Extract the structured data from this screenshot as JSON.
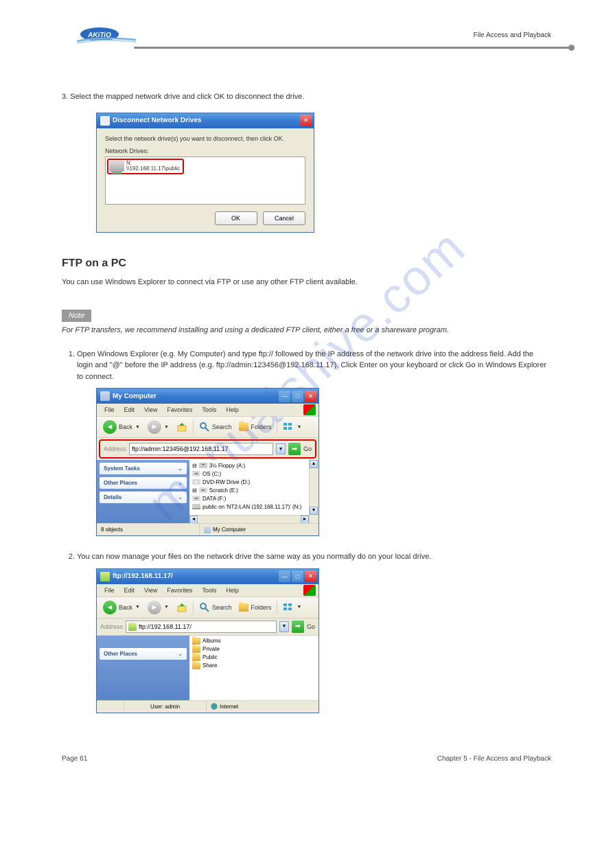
{
  "header": {
    "logo_text": "AKiTiO",
    "section_name": "File Access and Playback"
  },
  "intro_text": "3.  Select the mapped network drive and click OK to disconnect the drive.",
  "dialog1": {
    "title": "Disconnect Network Drives",
    "instruction": "Select the network drive(s) you want to disconnect, then click OK.",
    "label": "Network Drives:",
    "item_line1": "N:",
    "item_line2": "\\\\192.168.11.17\\public",
    "ok": "OK",
    "cancel": "Cancel"
  },
  "ftp_section": {
    "title": "FTP on a PC",
    "intro": "You can use Windows Explorer to connect via FTP or use any other FTP client available.",
    "note_label": "Note",
    "note_text": "For FTP transfers, we recommend installing and using a dedicated FTP client, either a free or a shareware program.",
    "steps": [
      "Open Windows Explorer (e.g. My Computer) and type ftp:// followed by the IP address of the network drive into the address field. Add the login and \"@\" before the IP address (e.g. ftp://admin:123456@192.168.11.17). Click Enter on your keyboard or click Go in Windows Explorer to connect.",
      "You can now manage your files on the network drive the same way as you normally do on your local drive."
    ]
  },
  "explorer1": {
    "title": "My Computer",
    "menus": [
      "File",
      "Edit",
      "View",
      "Favorites",
      "Tools",
      "Help"
    ],
    "back": "Back",
    "search": "Search",
    "folders": "Folders",
    "address_label": "Address",
    "address_value": "ftp://admin:123456@192.168.11.17",
    "go": "Go",
    "panels": [
      "System Tasks",
      "Other Places",
      "Details"
    ],
    "files": [
      "3½ Floppy (A:)",
      "OS (C:)",
      "DVD-RW Drive (D:)",
      "Scratch (E:)",
      "DATA (F:)",
      "public on 'NT2-LAN (192.168.11.17)' (N:)"
    ],
    "status_left": "8 objects",
    "status_right": "My Computer"
  },
  "explorer2": {
    "title": "ftp://192.168.11.17/",
    "menus": [
      "File",
      "Edit",
      "View",
      "Favorites",
      "Tools",
      "Help"
    ],
    "back": "Back",
    "search": "Search",
    "folders": "Folders",
    "address_label": "Address",
    "address_value": "ftp://192.168.11.17/",
    "go": "Go",
    "panels": [
      "Other Places"
    ],
    "files": [
      "Albums",
      "Private",
      "Public",
      "Share"
    ],
    "status_left": "User: admin",
    "status_right": "Internet"
  },
  "footer": {
    "left": "Page 61",
    "right": "Chapter 5 - File Access and Playback"
  },
  "watermark": "manualshive.com"
}
